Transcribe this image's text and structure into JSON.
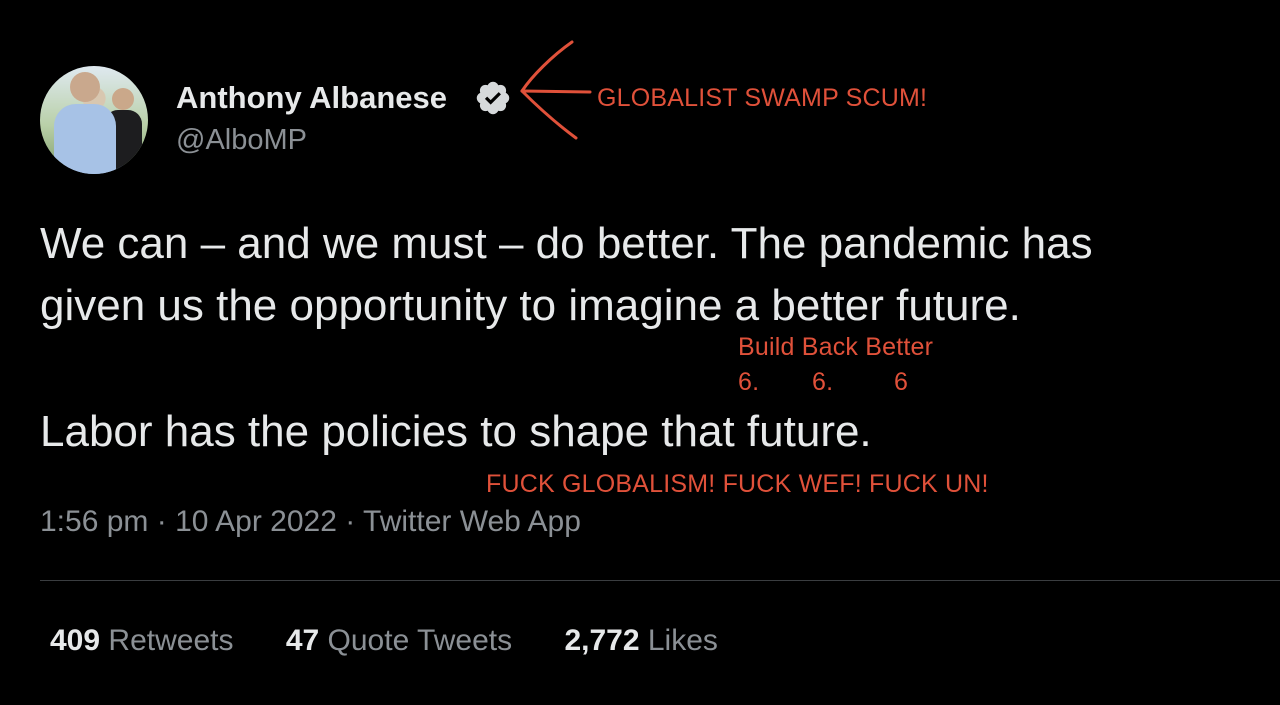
{
  "tweet": {
    "author_name": "Anthony Albanese",
    "handle": "@AlboMP",
    "line1": "We can – and we must – do better. The pandemic has",
    "line2": "given us the opportunity to imagine a better future.",
    "line3": "Labor has the policies to shape that future.",
    "time": "1:56 pm",
    "date": "10 Apr 2022",
    "source": "Twitter Web App",
    "separator": "·",
    "retweets_count": "409",
    "retweets_label": "Retweets",
    "quotes_count": "47",
    "quotes_label": "Quote Tweets",
    "likes_count": "2,772",
    "likes_label": "Likes"
  },
  "annotations": {
    "label_top": "GLOBALIST SWAMP SCUM!",
    "build_back": "Build Back Better",
    "num1": "6.",
    "num2": "6.",
    "num3": "6",
    "bottom": "FUCK GLOBALISM! FUCK WEF! FUCK UN!",
    "color": "#e0513a"
  },
  "icons": {
    "verified": "verified-badge-icon",
    "arrow": "red-arrow-annotation"
  }
}
